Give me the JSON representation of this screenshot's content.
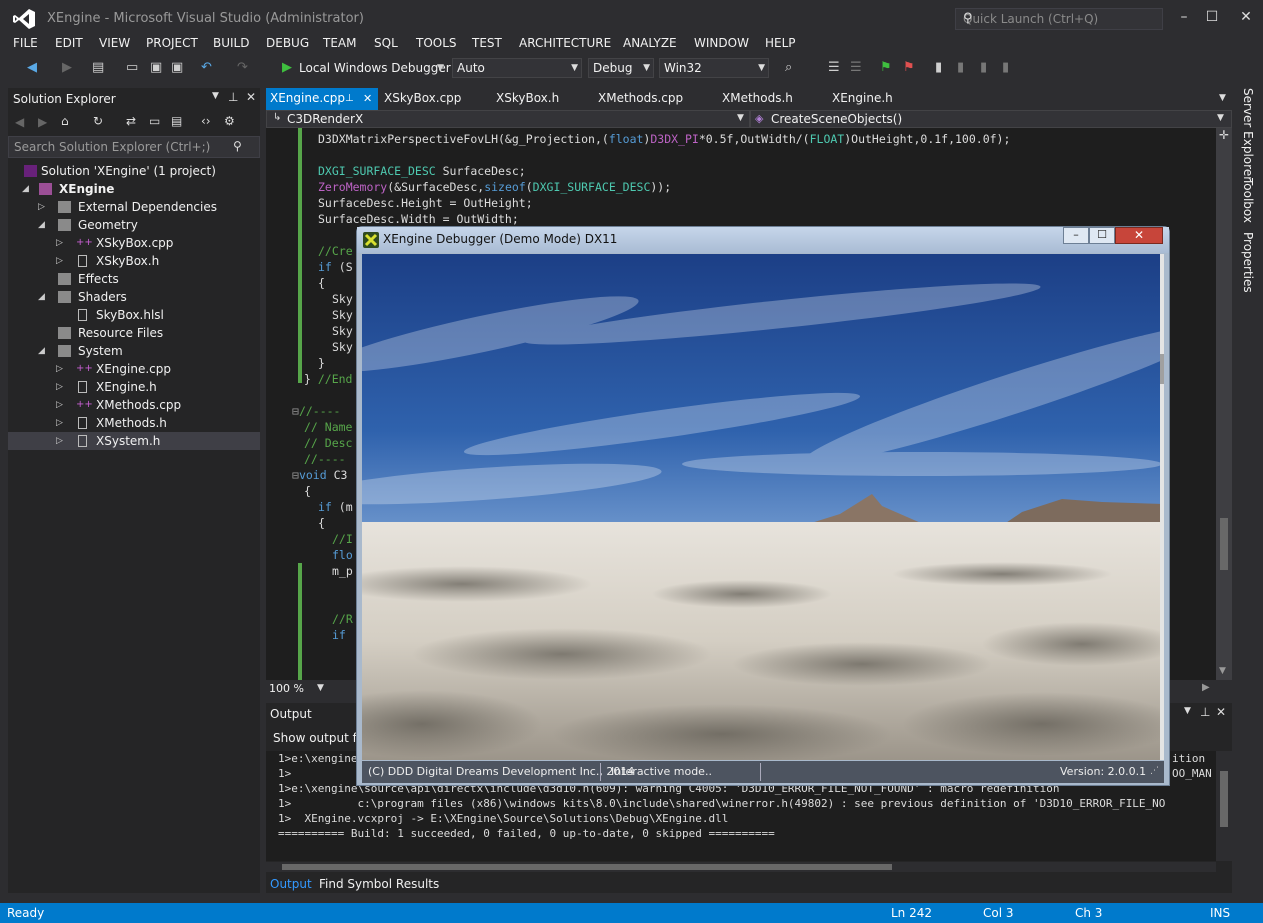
{
  "window": {
    "title": "XEngine - Microsoft Visual Studio (Administrator)",
    "quick_launch_placeholder": "Quick Launch (Ctrl+Q)"
  },
  "menu": [
    "FILE",
    "EDIT",
    "VIEW",
    "PROJECT",
    "BUILD",
    "DEBUG",
    "TEAM",
    "SQL",
    "TOOLS",
    "TEST",
    "ARCHITECTURE",
    "ANALYZE",
    "WINDOW",
    "HELP"
  ],
  "toolbar": {
    "debugger_label": "Local Windows Debugger",
    "solution_config_auto": "Auto",
    "config": "Debug",
    "platform": "Win32"
  },
  "solution_explorer": {
    "title": "Solution Explorer",
    "search_placeholder": "Search Solution Explorer (Ctrl+;)",
    "items": [
      {
        "label": "Solution 'XEngine' (1 project)"
      },
      {
        "label": "XEngine"
      },
      {
        "label": "External Dependencies"
      },
      {
        "label": "Geometry"
      },
      {
        "label": "XSkyBox.cpp"
      },
      {
        "label": "XSkyBox.h"
      },
      {
        "label": "Effects"
      },
      {
        "label": "Shaders"
      },
      {
        "label": "SkyBox.hlsl"
      },
      {
        "label": "Resource Files"
      },
      {
        "label": "System"
      },
      {
        "label": "XEngine.cpp"
      },
      {
        "label": "XEngine.h"
      },
      {
        "label": "XMethods.cpp"
      },
      {
        "label": "XMethods.h"
      },
      {
        "label": "XSystem.h"
      }
    ]
  },
  "tabs": [
    "XEngine.cpp",
    "XSkyBox.cpp",
    "XSkyBox.h",
    "XMethods.cpp",
    "XMethods.h",
    "XEngine.h"
  ],
  "nav": {
    "class": "C3DRenderX",
    "member": "CreateSceneObjects()"
  },
  "editor": {
    "zoom": "100 %"
  },
  "right_panel": [
    "Server Explorer",
    "Toolbox",
    "Properties"
  ],
  "output": {
    "title": "Output",
    "show_output_from": "Show output fr",
    "lines": [
      "1>e:\\xengine",
      "1>",
      "1>e:\\xengine\\source\\api\\directx\\include\\d3d10.h(609): warning C4005: 'D3D10_ERROR_FILE_NOT_FOUND' : macro redefinition",
      "1>          c:\\program files (x86)\\windows kits\\8.0\\include\\shared\\winerror.h(49802) : see previous definition of 'D3D10_ERROR_FILE_NO",
      "1>  XEngine.vcxproj -> E:\\XEngine\\Source\\Solutions\\Debug\\XEngine.dll",
      "========== Build: 1 succeeded, 0 failed, 0 up-to-date, 0 skipped =========="
    ],
    "right_fragments": [
      "ition",
      "OO_MAN"
    ],
    "bottom_tabs": [
      "Output",
      "Find Symbol Results"
    ]
  },
  "status": {
    "ready": "Ready",
    "line": "Ln 242",
    "col": "Col 3",
    "ch": "Ch 3",
    "mode": "INS"
  },
  "debugger_window": {
    "title": "XEngine Debugger (Demo Mode) DX11",
    "copyright": "(C) DDD Digital Dreams Development Inc., 2014",
    "mode": "Interactive mode..",
    "version": "Version: 2.0.0.1"
  },
  "colors": {
    "accent": "#007acc",
    "background": "#2d2d30",
    "editor": "#1e1e1e"
  }
}
